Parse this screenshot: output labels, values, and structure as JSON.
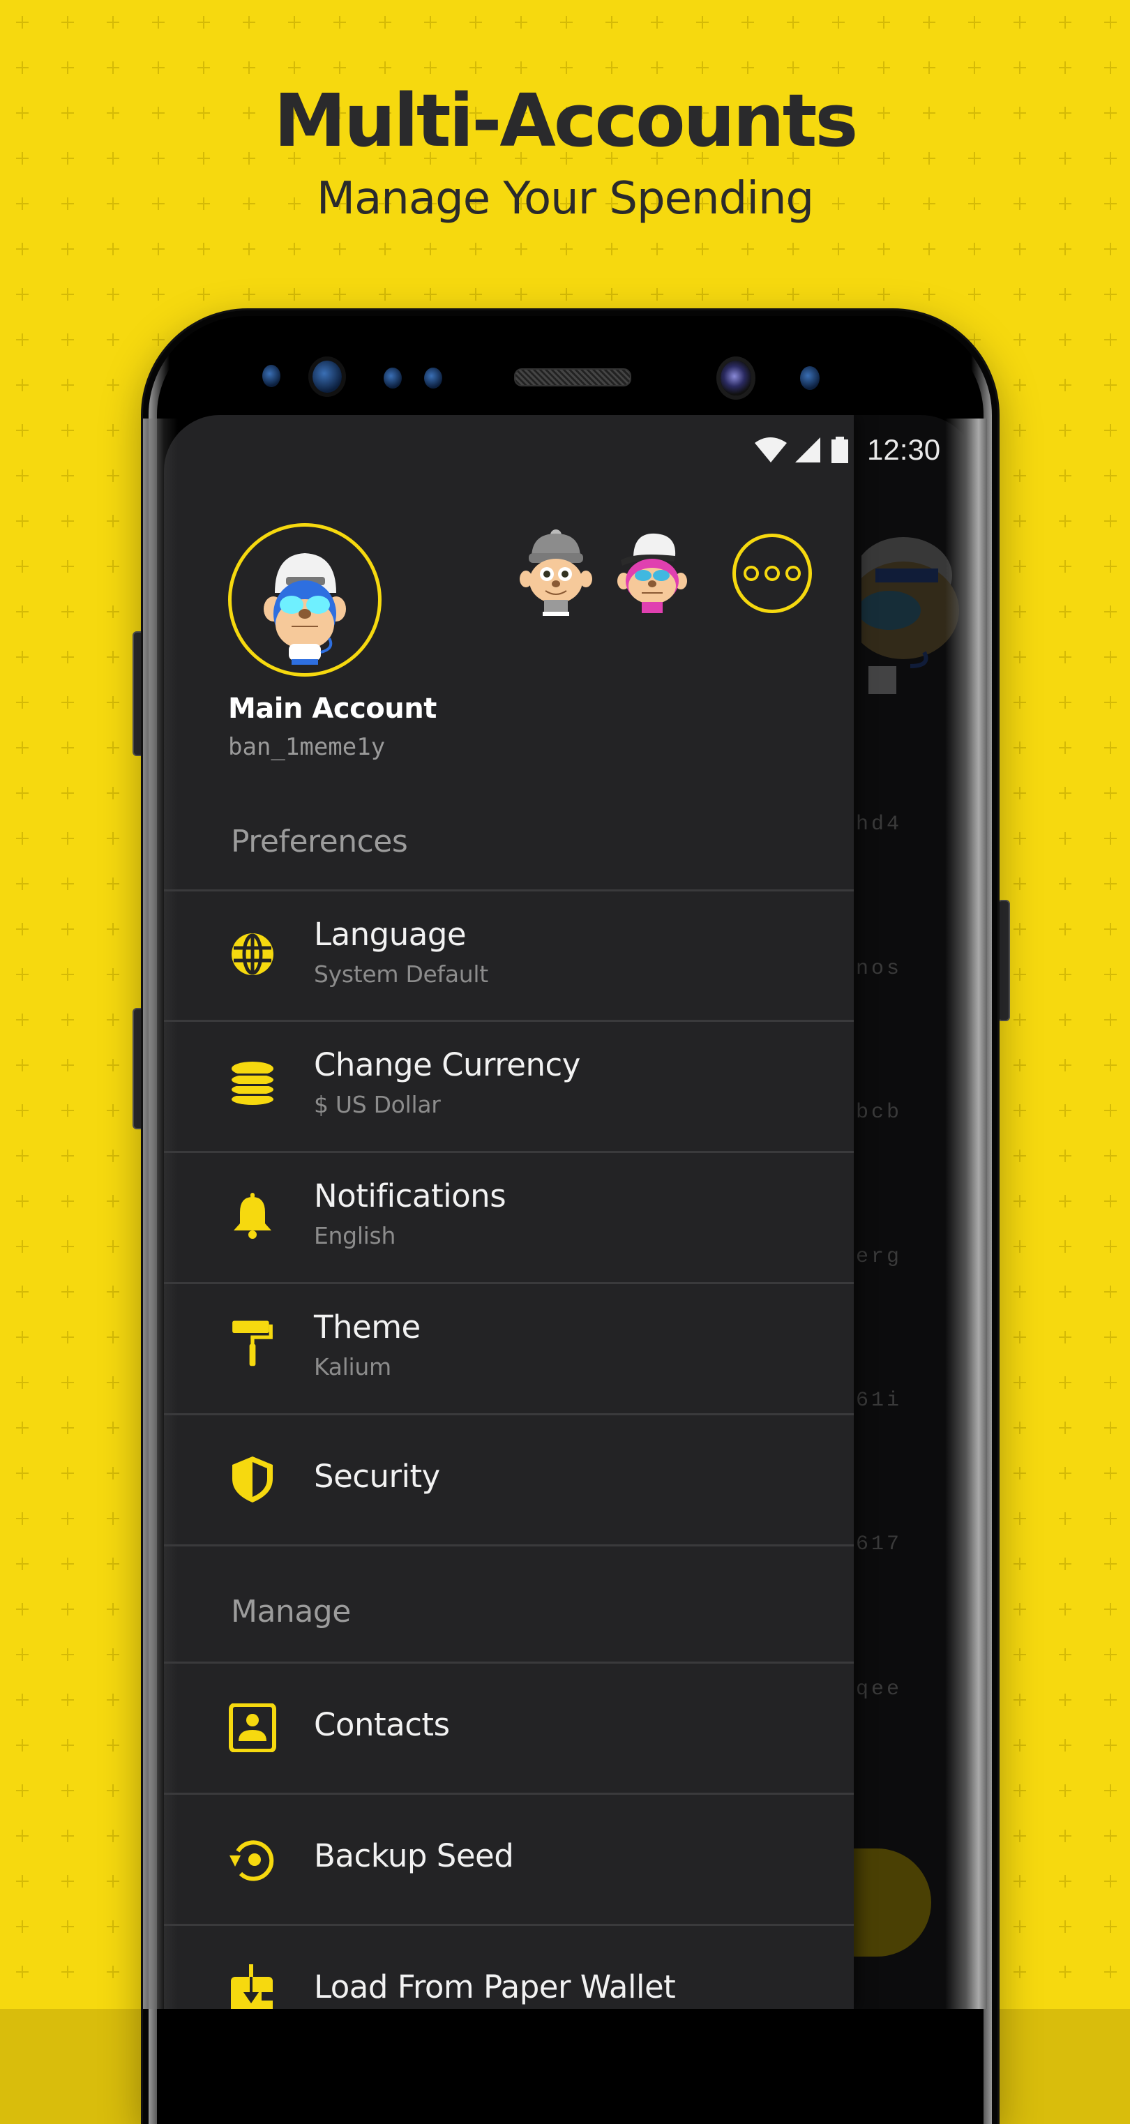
{
  "promo": {
    "headline": "Multi-Accounts",
    "subheadline": "Manage Your Spending"
  },
  "colors": {
    "accent": "#F6D90F",
    "background": "#F6D90F",
    "drawer": "#232325",
    "text_primary": "#F2F2F2",
    "text_secondary": "#8C8C8C"
  },
  "status_bar": {
    "time": "12:30",
    "icons": [
      "wifi-icon",
      "cellular-signal-icon",
      "battery-icon"
    ]
  },
  "account": {
    "name": "Main Account",
    "address": "ban_1meme1y",
    "avatar": "monkey-avatar-blue-cap",
    "other_accounts": [
      {
        "avatar": "monkey-avatar-gray-beanie"
      },
      {
        "avatar": "monkey-avatar-pink-cap"
      }
    ],
    "more_accounts_icon": "more-horizontal-icon"
  },
  "sections": {
    "preferences": {
      "header": "Preferences",
      "items": [
        {
          "icon": "globe-icon",
          "title": "Language",
          "subtitle": "System Default"
        },
        {
          "icon": "coins-icon",
          "title": "Change Currency",
          "subtitle": "$ US Dollar"
        },
        {
          "icon": "bell-icon",
          "title": "Notifications",
          "subtitle": "English"
        },
        {
          "icon": "paint-roller-icon",
          "title": "Theme",
          "subtitle": "Kalium"
        },
        {
          "icon": "shield-icon",
          "title": "Security",
          "subtitle": null
        }
      ]
    },
    "manage": {
      "header": "Manage",
      "items": [
        {
          "icon": "contact-card-icon",
          "title": "Contacts"
        },
        {
          "icon": "backup-restore-icon",
          "title": "Backup Seed"
        },
        {
          "icon": "paper-wallet-download-icon",
          "title": "Load From Paper Wallet"
        }
      ]
    }
  },
  "background_screen": {
    "address_fragments": [
      "hd4",
      "nos",
      "bcb",
      "erg",
      "61i",
      "617",
      "qee"
    ]
  }
}
